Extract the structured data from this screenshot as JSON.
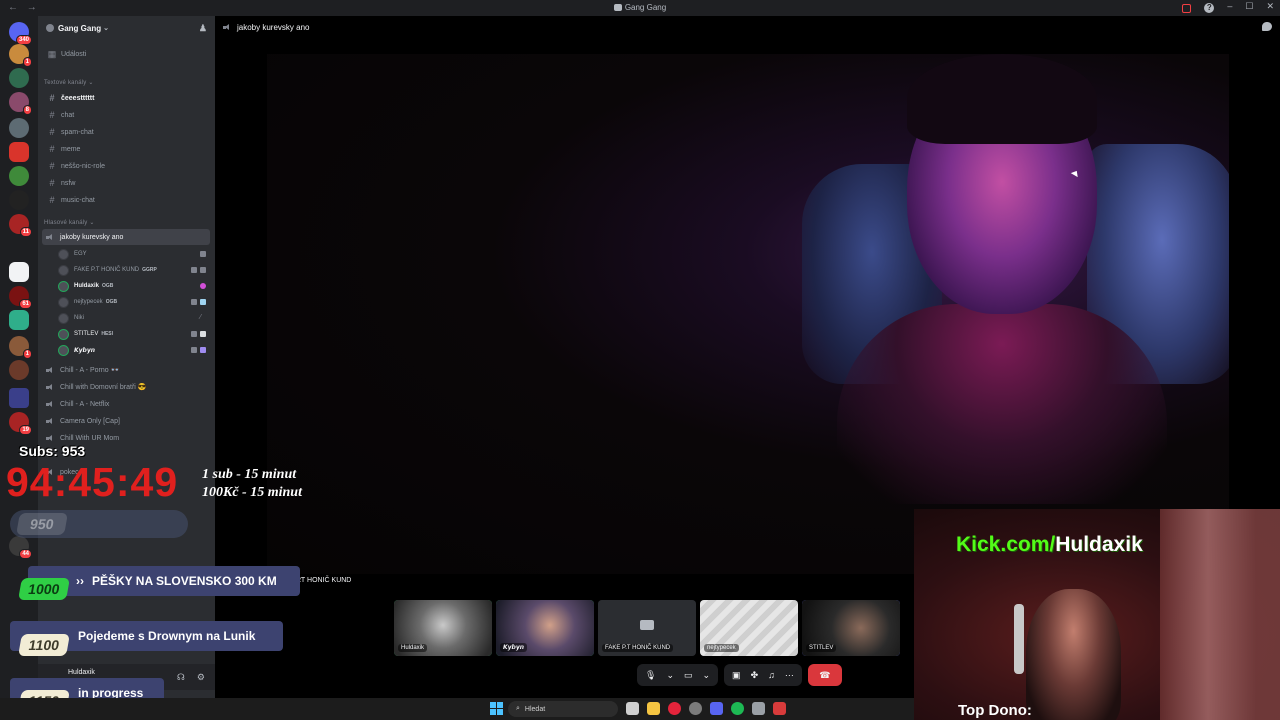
{
  "window": {
    "title": "Gang Gang"
  },
  "server": {
    "name": "Gang Gang"
  },
  "sidebar": {
    "events_label": "Události",
    "text_category": "Textové kanály",
    "text_channels": [
      {
        "label": "čeeestttttt",
        "unread": true
      },
      {
        "label": "chat"
      },
      {
        "label": "spam-chat"
      },
      {
        "label": "meme"
      },
      {
        "label": "neššo-nic-role"
      },
      {
        "label": "nsfw"
      },
      {
        "label": "music-chat"
      }
    ],
    "voice_category": "Hlasové kanály",
    "active_voice": "jakoby kurevsky ano",
    "voice_members": [
      {
        "label": "EGY"
      },
      {
        "label": "FAKE P.T HONIČ KUND",
        "tag": "GGRP"
      },
      {
        "label": "Huldaxik",
        "tag": "OGB"
      },
      {
        "label": "nejtypecek",
        "tag": "OGB"
      },
      {
        "label": "Niki"
      },
      {
        "label": "STITLEV",
        "tag": "HESI"
      },
      {
        "label": "𝙆𝙮𝙗𝙮𝙣"
      }
    ],
    "voice_channels": [
      {
        "label": "Chill - A - Porno 👓"
      },
      {
        "label": "Chill with Domovní bratři 😎"
      },
      {
        "label": "Chill - A - Netflix"
      },
      {
        "label": "Camera Only [Cap]"
      },
      {
        "label": "Chill With UR Mom"
      },
      {
        "label": "pokec"
      }
    ]
  },
  "user_panel": {
    "name": "Huldaxik"
  },
  "rail": {
    "badges": [
      "340",
      "1",
      "8",
      "11",
      "4",
      "61",
      "1",
      "19",
      "44"
    ]
  },
  "main": {
    "channel_title": "jakoby kurevsky ano",
    "partial_label": "RT HONIČ KUND",
    "tiles": [
      {
        "name": "Huldaxik"
      },
      {
        "name": "𝙆𝙮𝙗𝙮𝙣"
      },
      {
        "name": "FAKE P.T HONIČ KUND"
      },
      {
        "name": "nejtypecek"
      },
      {
        "name": "STITLEV"
      }
    ]
  },
  "overlay": {
    "subs": "Subs: 953",
    "timer": "94:45:49",
    "rule1": "1 sub - 15 minut",
    "rule2": "100Kč - 15 minut",
    "goal_950": "950",
    "goals": [
      {
        "amount": "1000",
        "label": "PĚŠKY NA SLOVENSKO 300 KM",
        "arrows": "››"
      },
      {
        "amount": "1100",
        "label": "Pojedeme s Drownym na Lunik"
      },
      {
        "amount": "1150",
        "label": "in progress"
      }
    ],
    "kick_prefix": "Kick.com/",
    "kick_suffix": "Huldaxik",
    "top_dono": "Top Dono:"
  },
  "taskbar": {
    "search_placeholder": "Hledat"
  },
  "colors": {
    "timer": "#e0201e",
    "kick": "#53fc18",
    "end_call": "#da373c",
    "speaking": "#23a55a"
  }
}
